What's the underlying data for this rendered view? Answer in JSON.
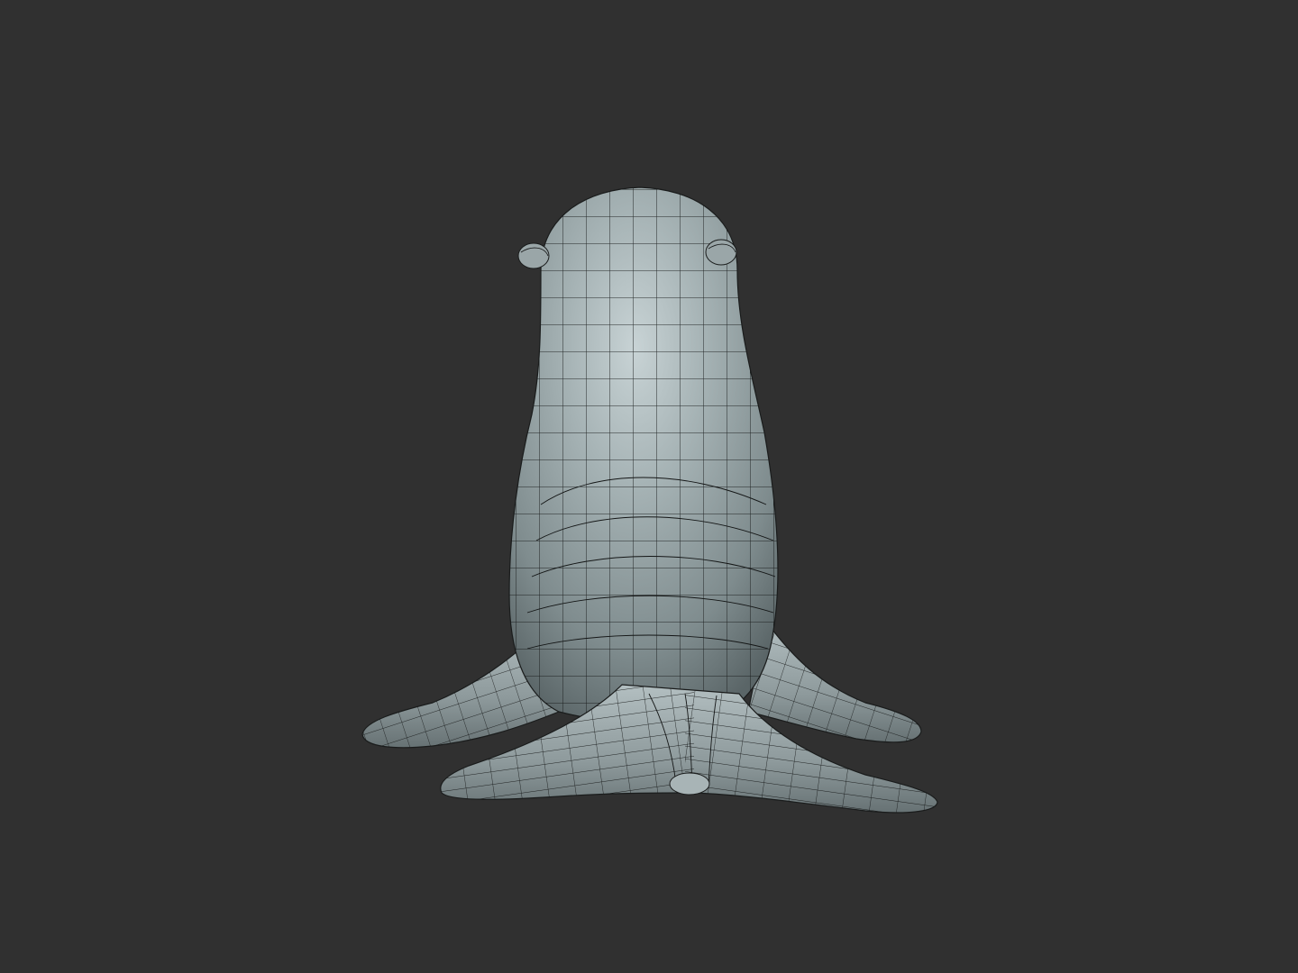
{
  "viewport": {
    "background_color": "#303030",
    "model": {
      "subject": "seal",
      "render_style": "wireframe-over-shaded",
      "surface_color": "#8d9a9c",
      "highlight_color": "#c4d0d2",
      "shadow_color": "#5f6a6c",
      "wire_color": "#141616"
    }
  }
}
